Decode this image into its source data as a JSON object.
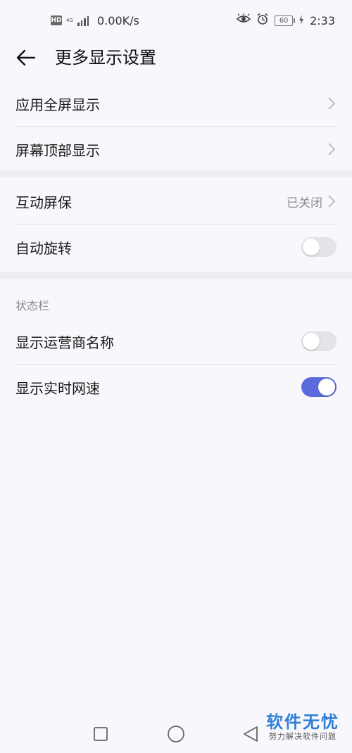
{
  "status_bar": {
    "hd_badge": "HD",
    "network_type": "4G",
    "net_speed": "0.00K/s",
    "battery": "60",
    "time": "2:33",
    "icons": [
      "hd-icon",
      "signal-icon",
      "eye-icon",
      "alarm-icon",
      "battery-icon",
      "charging-icon"
    ]
  },
  "header": {
    "title": "更多显示设置",
    "back_icon": "arrow-left-icon"
  },
  "group1": {
    "items": [
      {
        "label": "应用全屏显示",
        "trailing": "chevron-right-icon"
      },
      {
        "label": "屏幕顶部显示",
        "trailing": "chevron-right-icon"
      }
    ]
  },
  "group2": {
    "items": [
      {
        "label": "互动屏保",
        "value": "已关闭",
        "trailing": "chevron-right-icon"
      },
      {
        "label": "自动旋转",
        "toggle": false
      }
    ]
  },
  "status_section": {
    "title": "状态栏",
    "items": [
      {
        "label": "显示运营商名称",
        "toggle": false
      },
      {
        "label": "显示实时网速",
        "toggle": true
      }
    ]
  },
  "colors": {
    "accent": "#5c6bdc",
    "background": "#f8f7fb",
    "band": "#efedf2",
    "secondary_text": "#8b8b8f"
  },
  "nav_bar": {
    "icons": [
      "recents-square-icon",
      "home-circle-icon",
      "back-triangle-icon"
    ]
  },
  "watermark": {
    "main": "软件无忧",
    "sub": "努力解决软件问题"
  }
}
